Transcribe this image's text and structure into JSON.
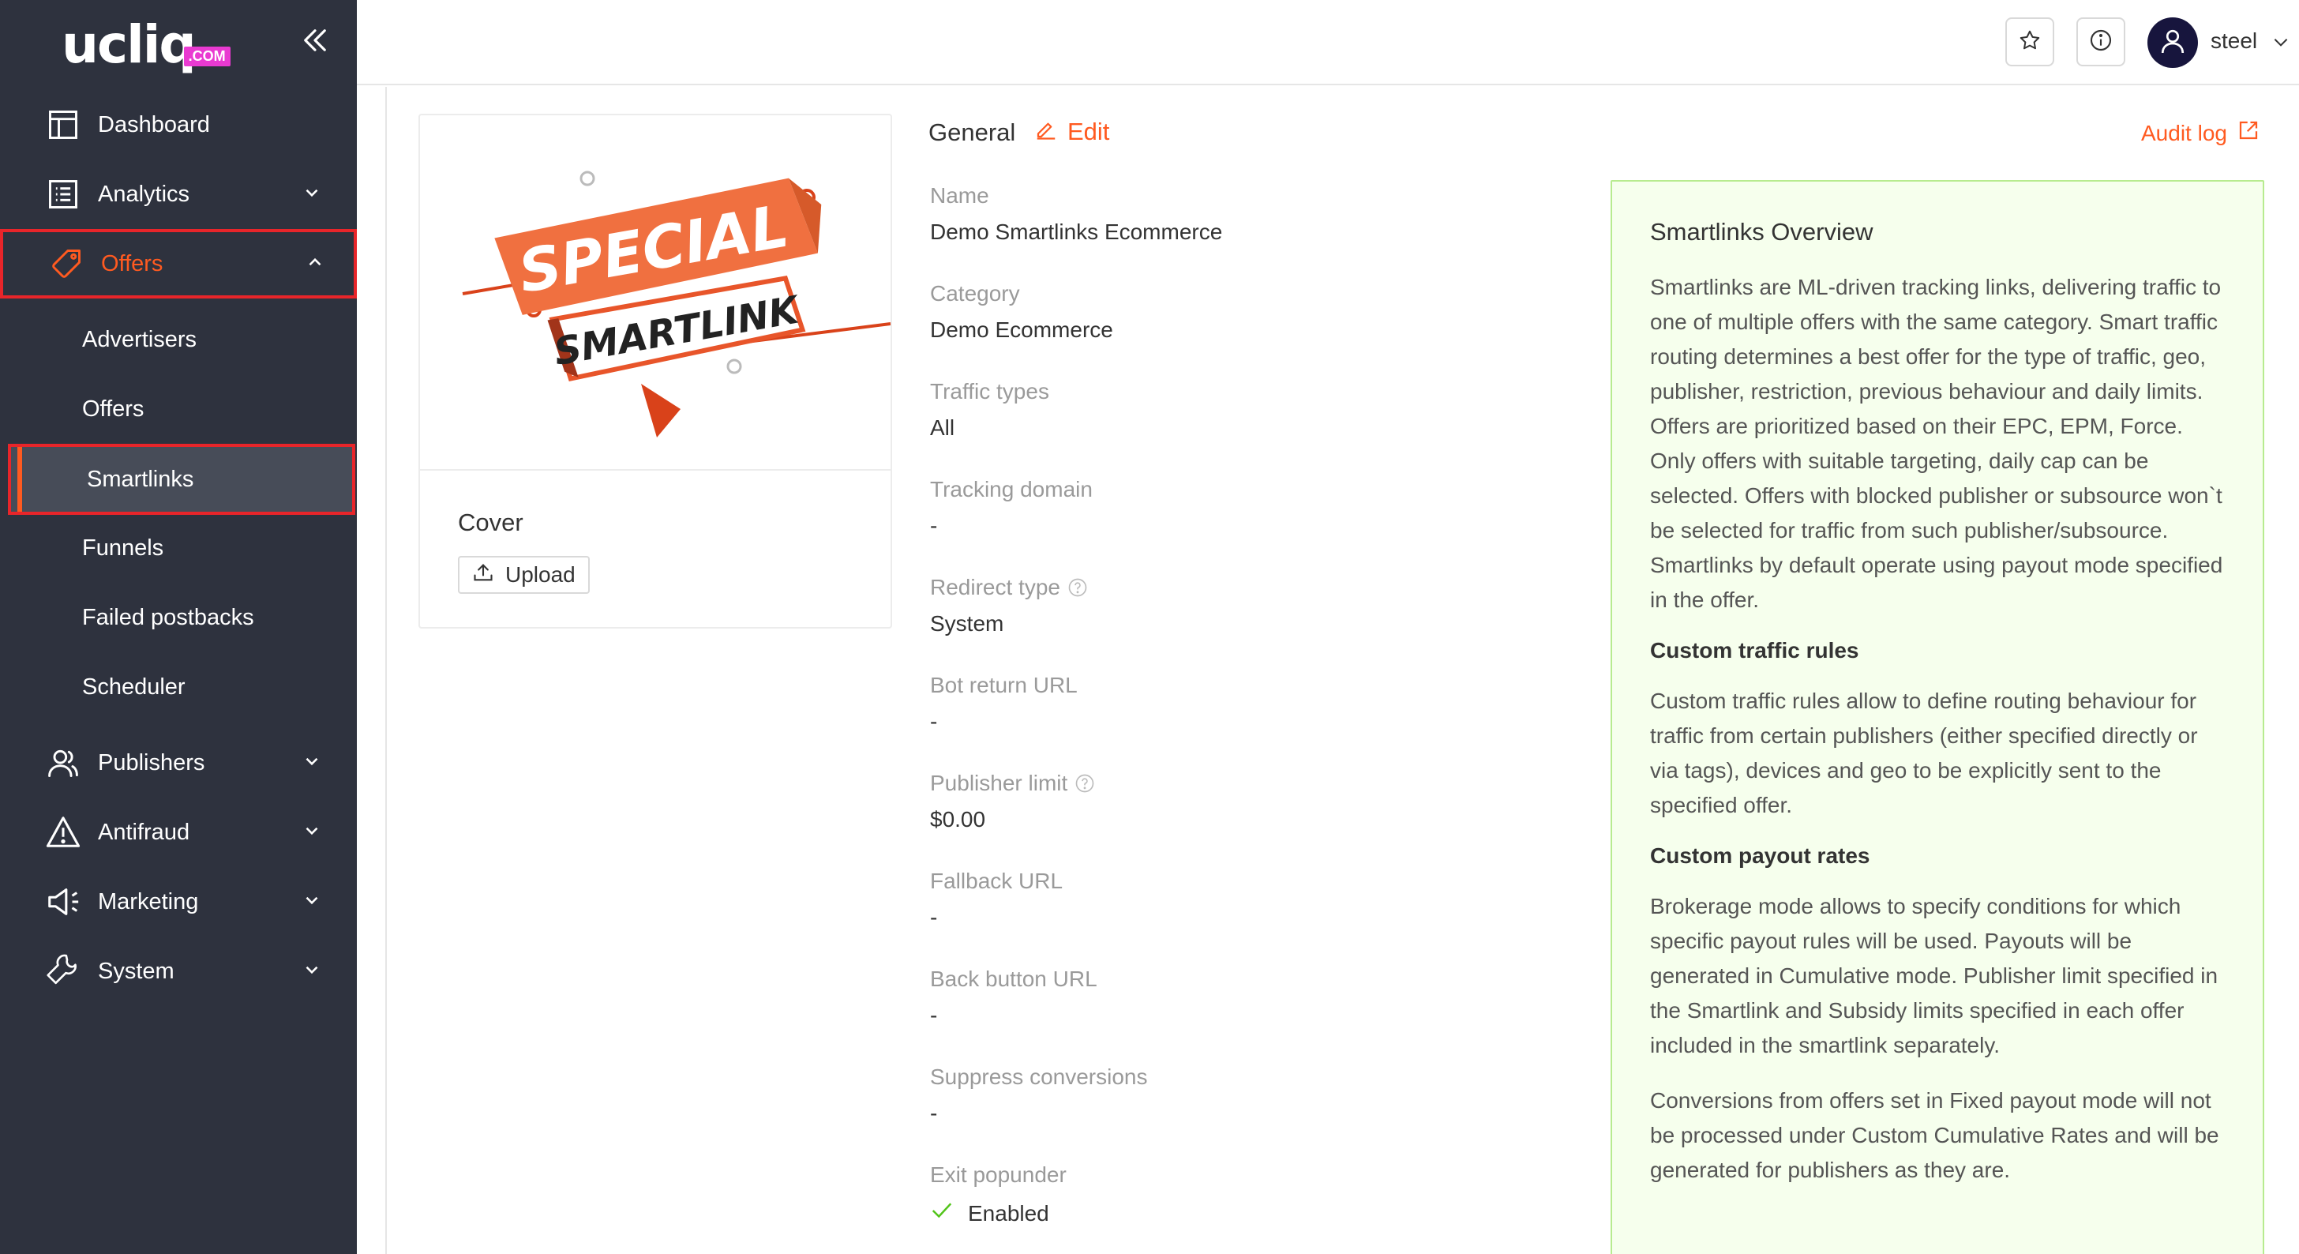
{
  "brand": {
    "logo_text": "ucliq",
    "logo_suffix": ".COM"
  },
  "sidebar": {
    "items": [
      {
        "label": "Dashboard",
        "icon": "dashboard-icon"
      },
      {
        "label": "Analytics",
        "icon": "analytics-icon"
      },
      {
        "label": "Offers",
        "icon": "tag-icon"
      },
      {
        "label": "Publishers",
        "icon": "users-icon"
      },
      {
        "label": "Antifraud",
        "icon": "warning-icon"
      },
      {
        "label": "Marketing",
        "icon": "megaphone-icon"
      },
      {
        "label": "System",
        "icon": "wrench-icon"
      }
    ],
    "offers_subitems": [
      {
        "label": "Advertisers"
      },
      {
        "label": "Offers"
      },
      {
        "label": "Smartlinks"
      },
      {
        "label": "Funnels"
      },
      {
        "label": "Failed postbacks"
      },
      {
        "label": "Scheduler"
      }
    ]
  },
  "topbar": {
    "user_name": "steel"
  },
  "cover": {
    "banner_line1": "SPECIAL",
    "banner_line2": "SMARTLINK",
    "title": "Cover",
    "upload_label": "Upload"
  },
  "general": {
    "title": "General",
    "edit_label": "Edit",
    "audit_label": "Audit log",
    "fields": [
      {
        "label": "Name",
        "value": "Demo Smartlinks Ecommerce"
      },
      {
        "label": "Category",
        "value": "Demo Ecommerce"
      },
      {
        "label": "Traffic types",
        "value": "All"
      },
      {
        "label": "Tracking domain",
        "value": "-"
      },
      {
        "label": "Redirect type",
        "value": "System"
      },
      {
        "label": "Bot return URL",
        "value": "-"
      },
      {
        "label": "Publisher limit",
        "value": "$0.00"
      },
      {
        "label": "Fallback URL",
        "value": "-"
      },
      {
        "label": "Back button URL",
        "value": "-"
      },
      {
        "label": "Suppress conversions",
        "value": "-"
      },
      {
        "label": "Exit popunder",
        "value": "Enabled"
      }
    ]
  },
  "overview": {
    "title": "Smartlinks Overview",
    "p1": "Smartlinks are ML-driven tracking links, delivering traffic to one of multiple offers with the same category. Smart traffic routing determines a best offer for the type of traffic, geo, publisher, restriction, previous behaviour and daily limits. Offers are prioritized based on their EPC, EPM, Force. Only offers with suitable targeting, daily cap can be selected. Offers with blocked publisher or subsource won`t be selected for traffic from such publisher/subsource. Smartlinks by default operate using payout mode specified in the offer.",
    "h2": "Custom traffic rules",
    "p2": "Custom traffic rules allow to define routing behaviour for traffic from certain publishers (either specified directly or via tags), devices and geo to be explicitly sent to the specified offer.",
    "h3": "Custom payout rates",
    "p3": "Brokerage mode allows to specify conditions for which specific payout rules will be used. Payouts will be generated in Cumulative mode. Publisher limit specified in the Smartlink and Subsidy limits specified in each offer included in the smartlink separately.",
    "p4": "Conversions from offers set in Fixed payout mode will not be processed under Custom Cumulative Rates and will be generated for publishers as they are."
  },
  "colors": {
    "accent": "#ff5a20",
    "sidebar_bg": "#2e323e",
    "highlight": "#e8252a",
    "overview_bg": "#f6ffed"
  }
}
